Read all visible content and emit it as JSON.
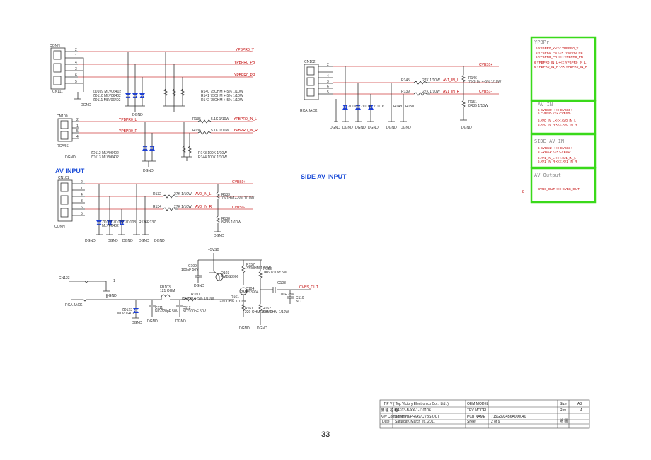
{
  "headings": {
    "av_input": "AV INPUT",
    "side_av_input": "SIDE AV INPUT"
  },
  "conn_ypbpr": {
    "name": "CONN",
    "ref": "CN111",
    "pins": [
      "2",
      "1",
      "4",
      "3",
      "6",
      "5"
    ],
    "nets": {
      "y": "YPBPR0_Y",
      "pb": "YPBPR0_PB",
      "pr": "YPBPR0_PR"
    },
    "diodes": "ZD109   MLV06402\nZD110   MLV06402\nZD111   MLV06402",
    "resistors": "R140     75OHM +-5% 1/10W\nR141     75OHM +-5% 1/10W\nR142     75OHM +-5% 1/10W",
    "gnd": "DGND"
  },
  "conn_lr": {
    "ref": "CN100",
    "name": "RCA/IS",
    "pins": [
      "2",
      "1",
      "5",
      "4"
    ],
    "r1": "R135",
    "r1v": "5.1K 1/10W",
    "net1": "YPBPR0_IN_L",
    "r2": "R136",
    "r2v": "5.1K 1/10W",
    "net2": "YPBPR0_IN_R",
    "in1": "YPBPR0_L",
    "in2": "YPBPR0_R",
    "diodes": "ZD112   MLV06402\nZD113   MLV06402",
    "resistors": "R143   100K 1/10W\nR144   100K 1/10W",
    "gnd": "DGND"
  },
  "av_input": {
    "ref": "CN101",
    "name": "CONN",
    "pins": [
      "2",
      "1",
      "4",
      "3",
      "6",
      "5"
    ],
    "cvbs": "CVBS0+",
    "cvbsm": "CVBS0-",
    "r132": "R132",
    "r132v": "27K 1/10W",
    "net_l": "AV0_IN_L",
    "r134": "R134",
    "r134v": "27K 1/10W",
    "net_r": "AV0_IN_R",
    "r133": "R133\n75OHM +-5% 1/10W",
    "r138": "R138\n8R35 1/10W",
    "parts": [
      "ZD101\nMLV06402",
      "ZD102\nMLV06402",
      "ZD108\nMLV06402",
      "R136\n100K 1/",
      "R137\n100K 1/10W"
    ],
    "gnd": "DGND"
  },
  "side_av": {
    "ref": "CN102",
    "name": "RCA JACK",
    "pins": [
      "2",
      "1",
      "4",
      "3",
      "6",
      "5"
    ],
    "cvbs": "CVBS1+",
    "cvbsm": "CVBS1-",
    "r145": "R145",
    "r145v": "27K 1/10W",
    "net_l": "AV1_IN_L",
    "r139": "R139",
    "r139v": "27K 1/10W",
    "net_r": "AV1_IN_R",
    "r146": "R146\n75OHM +-5% 1/10W",
    "r151": "R151\n8R35 1/10W",
    "parts": [
      "ZD115\nMLV06402",
      "ZD114\nMLV06402",
      "ZD116\nMLV06402",
      "R149\n100K",
      "R150\n100K 1/10W"
    ],
    "gnd": "DGND"
  },
  "av_out": {
    "supply": "+5VSB",
    "c109": "C109\n100nF 50V",
    "q103": "Q103\nPMBS3906",
    "r157": "R157\n3300HM 1/10W",
    "r158": "R158\n7K6 1/10W 5%",
    "q104": "Q104\nPMBS3904",
    "c108": "C108",
    "c108v": "10uF 25V",
    "net_out": "CVBS_OUT",
    "c110": "C110\nNC",
    "r161": "R161\n220 OHM 1/10W",
    "r162": "R162\n330 OHM 1/10W",
    "r160": "R160",
    "r160v": "75OHM +-5% 1/10W",
    "r161b": "R161",
    "r161bv": "220 OHM 1/10W",
    "fb": "FB103\n121 OHM",
    "c111": "C111\nNC/220pF 50V",
    "c112": "C112\nNC/100pF 50V",
    "cn": "CN123",
    "jack": "RCA JACK",
    "zd": "ZD123\nMLV06402",
    "gnd": "DGND"
  },
  "ports": {
    "ypbpr": {
      "title": "YPBPr",
      "items": [
        "6  YPBPR0_Y  <<<  YPBPR0_Y",
        "6  YPBPR0_PB <<<  YPBPR0_PB",
        "6  YPBPR0_PR <<<  YPBPR0_PR",
        "6  YPBPR0_IN_L <<<  YPBPR0_IN_L",
        "6  YPBPR0_IN_R <<<  YPBPR0_IN_R"
      ]
    },
    "av_in": {
      "title": "AV IN",
      "items": [
        "6  CVBS0+  <<<  CVBS0+",
        "6  CVBS0-  <<<  CVBS0-",
        "6  AV0_IN_L <<<  AV0_IN_L",
        "6  AV0_IN_R <<<  AV0_IN_R"
      ]
    },
    "side_av_in": {
      "title": "SIDE AV IN",
      "items": [
        "6  CVBS1+  <<<  CVBS1+",
        "6  CVBS1-  <<<  CVBS1-",
        "6  AV1_IN_L <<<  AV1_IN_L",
        "6  AV1_IN_R <<<  AV1_IN_R"
      ]
    },
    "av_output": {
      "title": "AV Output",
      "items": [
        "CVBS_OUT  <<<  CVBS_OUT"
      ]
    }
  },
  "titleblock": {
    "company": "T P V  ( Top   Victory   Electronics   Co .,  Ltd. )",
    "oem_model": "OEM MODEL",
    "size": "Size",
    "size_val": "A3",
    "row2_label": "機 種 名 稱",
    "row2_val": "Q4703-B-XX-1-110106",
    "tpv_model": "TPV MODEL",
    "rev": "Rev",
    "rev_val": "A",
    "row3_label": "Key Component",
    "row3_val": "S2) Y PB/PR/AV/CVBS OUT",
    "pcb_name": "PCB NAME",
    "pcb_val": "715G3934B6A000040",
    "date_label": "Date",
    "date_val": "Saturday, March 26, 2011",
    "sheet": "Sheet",
    "sheet_val": "2    of    9",
    "drawer": "繪 圖"
  },
  "page_number": "33"
}
